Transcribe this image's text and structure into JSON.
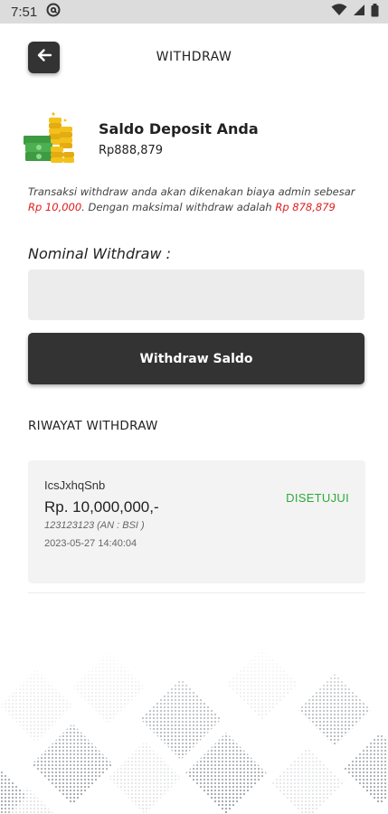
{
  "status_bar": {
    "time": "7:51"
  },
  "header": {
    "title": "WITHDRAW"
  },
  "balance": {
    "title": "Saldo Deposit Anda",
    "amount": "Rp888,879"
  },
  "notice": {
    "text_1": "Transaksi withdraw anda akan dikenakan biaya admin sebesar ",
    "admin_fee": "Rp 10,000",
    "text_2": ". Dengan maksimal withdraw adalah ",
    "max_withdraw": "Rp 878,879"
  },
  "form": {
    "nominal_label": "Nominal Withdraw :",
    "nominal_value": "",
    "submit_label": "Withdraw Saldo"
  },
  "history": {
    "title": "RIWAYAT WITHDRAW",
    "items": [
      {
        "name": "IcsJxhqSnb",
        "amount": "Rp. 10,000,000,-",
        "account": "123123123 (AN : BSI )",
        "date": "2023-05-27 14:40:04",
        "status": "DISETUJUI"
      }
    ]
  },
  "colors": {
    "primary_dark": "#333333",
    "highlight_red": "#e01c1c",
    "status_approved": "#2eaa3a",
    "input_bg": "#ececec",
    "card_bg": "#f3f3f3"
  },
  "icons": [
    "at-sign-icon",
    "wifi-icon",
    "signal-icon",
    "battery-icon",
    "back-arrow-icon",
    "money-coins-icon"
  ]
}
